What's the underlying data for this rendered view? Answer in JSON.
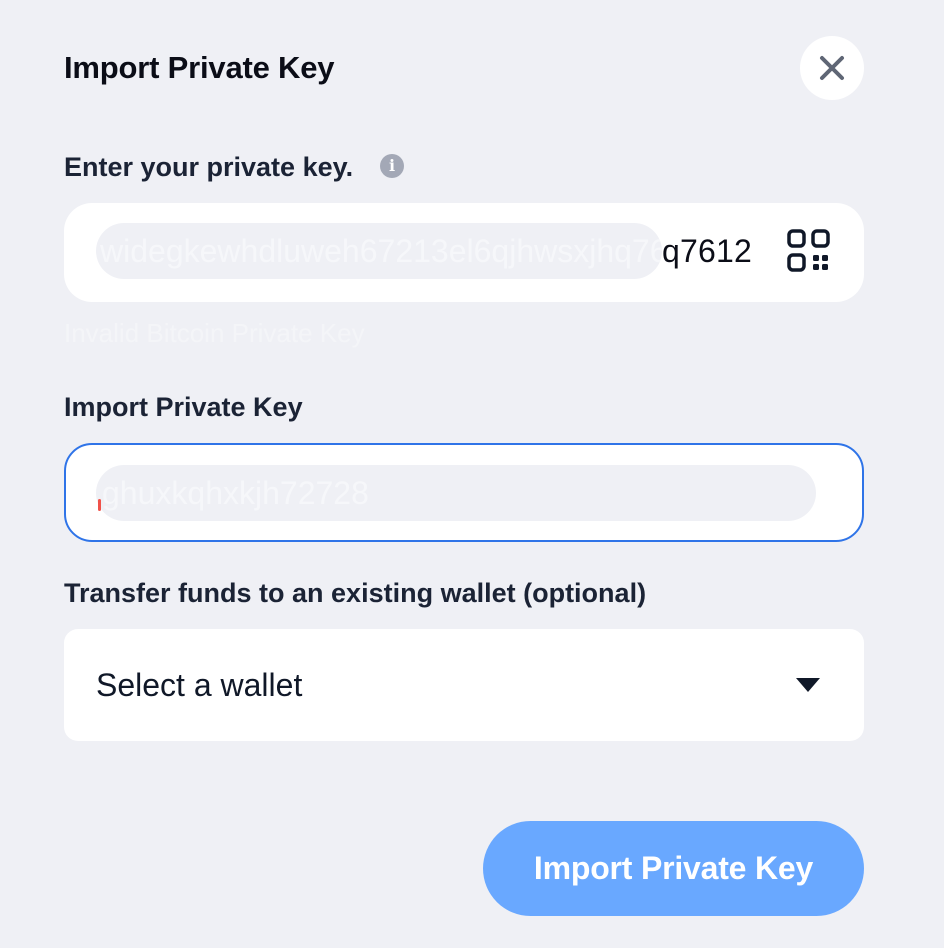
{
  "dialog": {
    "title": "Import Private Key",
    "close_icon": "close-icon"
  },
  "private_key": {
    "label": "Enter your private key.",
    "info_icon": "info-icon",
    "info_glyph": "i",
    "visible_value": "q7612",
    "masked_value": "widegkewhdluweh67213el6qjhwsxjhq7612",
    "scan_icon": "qr-scan-icon",
    "error": "Invalid Bitcoin Private Key"
  },
  "import_key": {
    "label": "Import Private Key",
    "masked_value": "ghuxkqhxkjh72728"
  },
  "transfer": {
    "label": "Transfer funds to an existing wallet (optional)",
    "selected": "Select a wallet",
    "dropdown_icon": "chevron-down-icon"
  },
  "submit": {
    "label": "Import Private Key"
  },
  "colors": {
    "background": "#eff0f5",
    "accent": "#2f74e8",
    "button": "#69a8ff"
  }
}
